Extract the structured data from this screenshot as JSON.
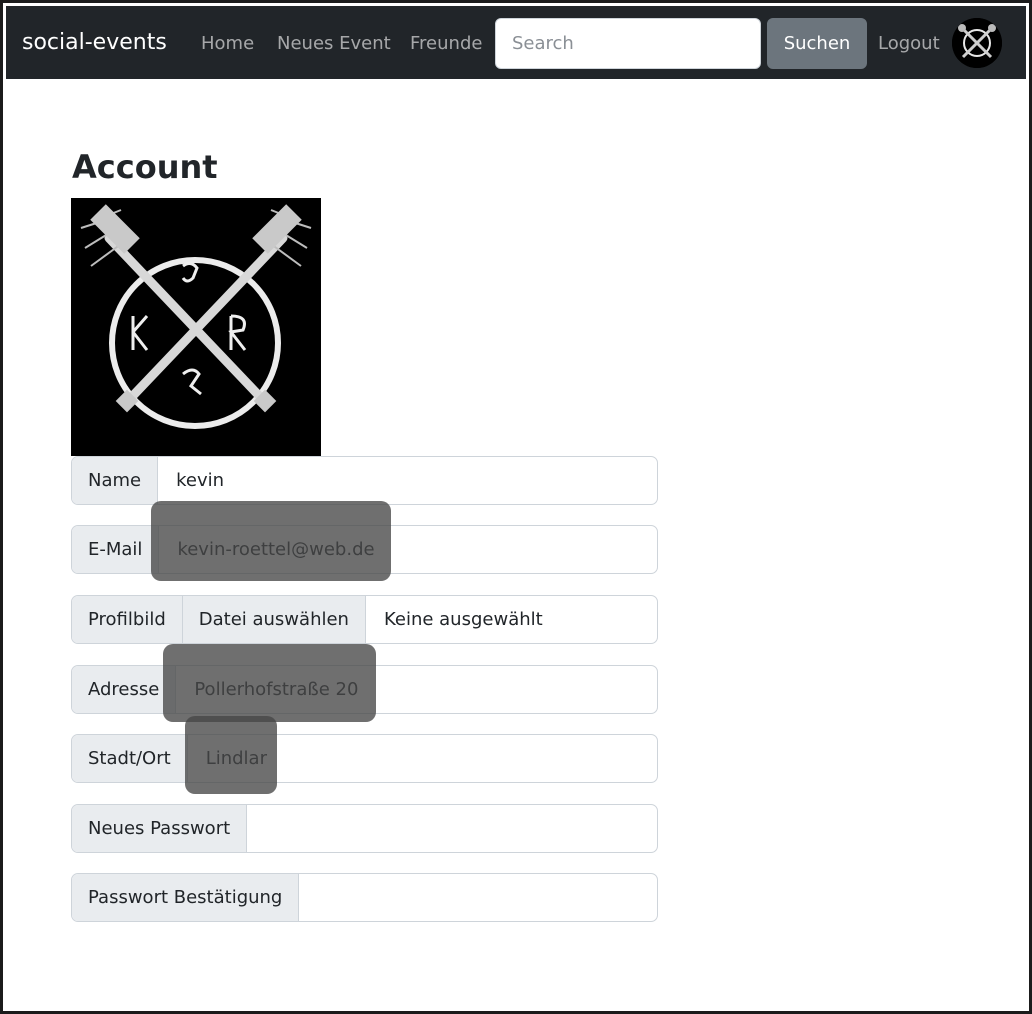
{
  "navbar": {
    "brand": "social-events",
    "links": [
      "Home",
      "Neues Event",
      "Freunde"
    ],
    "search_placeholder": "Search",
    "search_button": "Suchen",
    "logout": "Logout"
  },
  "page": {
    "title": "Account"
  },
  "form": {
    "name_label": "Name",
    "name_value": "kevin",
    "email_label": "E-Mail",
    "email_value": "kevin-roettel@web.de",
    "picture_label": "Profilbild",
    "picture_button": "Datei auswählen",
    "picture_value": "Keine ausgewählt",
    "address_label": "Adresse",
    "address_value": "Pollerhofstraße 20",
    "city_label": "Stadt/Ort",
    "city_value": "Lindlar",
    "password_label": "Neues Passwort",
    "password_value": "",
    "confirm_label": "Passwort Bestätigung",
    "confirm_value": ""
  },
  "colors": {
    "navbar_bg": "#212529",
    "button_secondary": "#6c757d",
    "addon_bg": "#e9ecef",
    "border": "#ced4da"
  },
  "icons": {
    "avatar": "crossed-maces-logo",
    "profile_image": "crossed-maces-logo"
  }
}
